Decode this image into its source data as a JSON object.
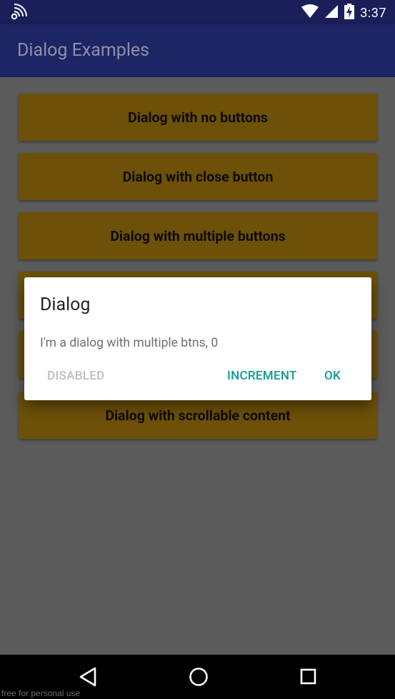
{
  "status_bar": {
    "time": "3:37",
    "icons": [
      "cast-icon",
      "wifi-icon",
      "signal-icon",
      "battery-charging-icon"
    ]
  },
  "app_bar": {
    "title": "Dialog Examples"
  },
  "buttons": [
    {
      "label": "Dialog with no buttons"
    },
    {
      "label": "Dialog with close button"
    },
    {
      "label": "Dialog with multiple buttons"
    },
    {
      "label": ""
    },
    {
      "label": ""
    },
    {
      "label": "Dialog with scrollable content"
    }
  ],
  "dialog": {
    "title": "Dialog",
    "message": "I'm a dialog with multiple btns, 0",
    "disabled_label": "DISABLED",
    "increment_label": "INCREMENT",
    "ok_label": "OK"
  },
  "nav_bar": {
    "icons": [
      "back-icon",
      "home-icon",
      "recents-icon"
    ]
  },
  "watermark": "free for personal use",
  "colors": {
    "status_bar": "#1a1f5a",
    "app_bar": "#1e2565",
    "button": "#6d5108",
    "accent": "#0a9a8c",
    "scrim_background": "#5b5b5b"
  }
}
